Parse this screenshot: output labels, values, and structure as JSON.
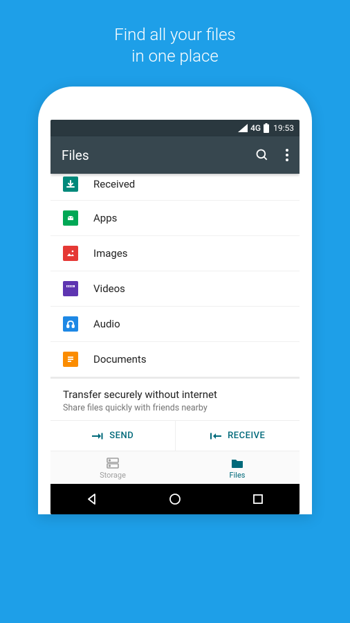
{
  "promo": {
    "line1": "Find all your files",
    "line2": "in one place"
  },
  "status": {
    "network": "4G",
    "time": "19:53"
  },
  "appbar": {
    "title": "Files"
  },
  "categories": [
    {
      "label": "Received"
    },
    {
      "label": "Apps"
    },
    {
      "label": "Images"
    },
    {
      "label": "Videos"
    },
    {
      "label": "Audio"
    },
    {
      "label": "Documents"
    }
  ],
  "transfer": {
    "title": "Transfer securely without internet",
    "subtitle": "Share files quickly with friends nearby",
    "send": "SEND",
    "receive": "RECEIVE"
  },
  "nav": {
    "storage": "Storage",
    "files": "Files"
  }
}
